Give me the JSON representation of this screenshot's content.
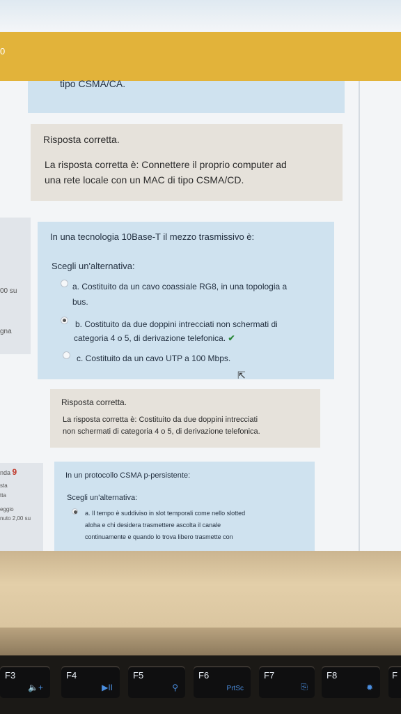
{
  "header": {
    "number": "0"
  },
  "previous_question": {
    "tail": "tipo CSMA/CA."
  },
  "feedback1": {
    "title": "Risposta corretta.",
    "line1": "La risposta corretta è: Connettere il proprio computer ad",
    "line2": "una rete locale con un MAC di tipo CSMA/CD."
  },
  "sidebar1": {
    "line1": "00 su",
    "line2": "gna"
  },
  "question1": {
    "text": "In una tecnologia 10Base-T il mezzo trasmissivo è:",
    "prompt": "Scegli un'alternativa:",
    "options": [
      {
        "line1": "a. Costituito da un cavo coassiale RG8, in una topologia a",
        "line2": "bus."
      },
      {
        "line1": "b. Costituito da due doppini intrecciati non schermati di",
        "line2": "categoria 4 o 5, di derivazione telefonica."
      },
      {
        "line1": "c. Costituito da un cavo UTP a 100 Mbps."
      }
    ]
  },
  "feedback2": {
    "title": "Risposta corretta.",
    "line1": "La risposta corretta è: Costituito da due doppini intrecciati",
    "line2": "non schermati di categoria 4 o 5, di derivazione telefonica."
  },
  "sidebar2": {
    "label": "nda",
    "number": "9",
    "line1": "sta",
    "line2": "tta",
    "line3": "eggio",
    "line4": "nuto 2,00 su"
  },
  "question2": {
    "text": "In un protocollo CSMA p-persistente:",
    "prompt": "Scegli un'alternativa:",
    "option_a": {
      "line1": "a. Il tempo è suddiviso in slot temporali come nello slotted",
      "line2": "aloha e chi desidera trasmettere ascolta il canale",
      "line3": "continuamente e quando lo trova libero trasmette con"
    }
  },
  "keyboard": {
    "keys": [
      {
        "label": "F3",
        "icon": "🔈+"
      },
      {
        "label": "F4",
        "icon": "▶II"
      },
      {
        "label": "F5",
        "icon": "⚲"
      },
      {
        "label": "F6",
        "icon": "PrtSc"
      },
      {
        "label": "F7",
        "icon": "⎘"
      },
      {
        "label": "F8",
        "icon": "✹"
      },
      {
        "label": "F"
      }
    ]
  }
}
